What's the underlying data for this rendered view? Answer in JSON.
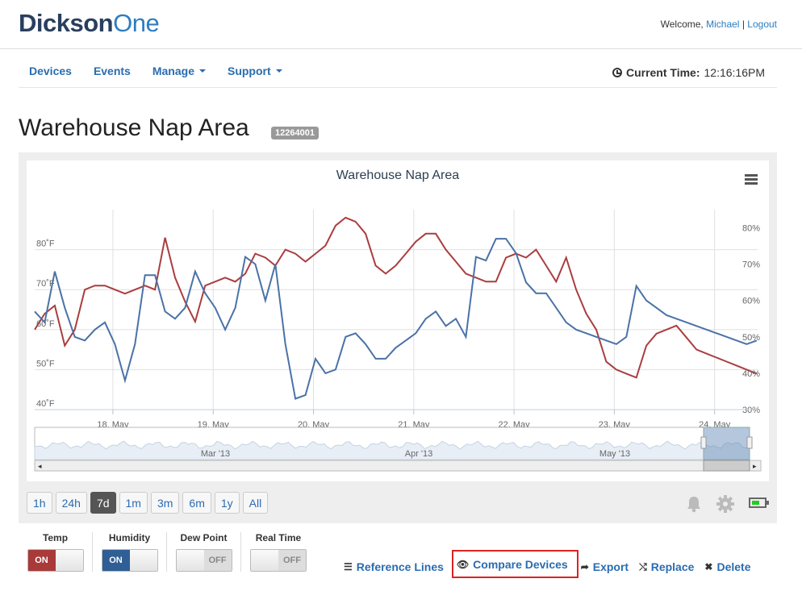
{
  "header": {
    "logo_a": "Dickson",
    "logo_b": "One",
    "welcome": "Welcome,",
    "user": "Michael",
    "separator": "|",
    "logout": "Logout"
  },
  "nav": {
    "devices": "Devices",
    "events": "Events",
    "manage": "Manage",
    "support": "Support",
    "current_time_label": "Current Time:",
    "current_time_value": "12:16:16PM"
  },
  "page": {
    "title": "Warehouse Nap Area",
    "badge": "12264001"
  },
  "chart_data": {
    "type": "line",
    "title": "Warehouse Nap Area",
    "x_ticks": [
      "18. May",
      "19. May",
      "20. May",
      "21. May",
      "22. May",
      "23. May",
      "24. May"
    ],
    "y_left_ticks": [
      "40˚F",
      "50˚F",
      "60˚F",
      "70˚F",
      "80˚F"
    ],
    "y_right_ticks": [
      "30%",
      "40%",
      "50%",
      "60%",
      "70%",
      "80%"
    ],
    "ylim_left": [
      40,
      90
    ],
    "ylim_right": [
      30,
      85
    ],
    "navigator_labels": [
      "Mar '13",
      "Apr '13",
      "May '13"
    ],
    "series": [
      {
        "name": "Temp",
        "color": "#aa3d3f",
        "axis": "left",
        "x": [
          17.0,
          17.1,
          17.2,
          17.3,
          17.4,
          17.5,
          17.6,
          17.7,
          17.8,
          17.9,
          18.0,
          18.1,
          18.2,
          18.3,
          18.4,
          18.5,
          18.6,
          18.7,
          18.8,
          18.9,
          19.0,
          19.1,
          19.2,
          19.3,
          19.4,
          19.5,
          19.6,
          19.7,
          19.8,
          19.9,
          20.0,
          20.1,
          20.2,
          20.3,
          20.4,
          20.5,
          20.6,
          20.7,
          20.8,
          20.9,
          21.0,
          21.1,
          21.2,
          21.3,
          21.4,
          21.5,
          21.6,
          21.7,
          21.8,
          21.9,
          22.0,
          22.1,
          22.2,
          22.3,
          22.4,
          22.5,
          22.6,
          22.7,
          22.8,
          22.9,
          23.0,
          23.1,
          23.2,
          23.3,
          23.4,
          23.5,
          23.6,
          23.7,
          23.8,
          23.9,
          24.0,
          24.1,
          24.2
        ],
        "values": [
          60,
          64,
          66,
          56,
          60,
          70,
          71,
          71,
          70,
          69,
          70,
          71,
          70,
          83,
          73,
          67,
          62,
          71,
          72,
          73,
          72,
          74,
          79,
          78,
          76,
          80,
          79,
          77,
          79,
          81,
          86,
          88,
          87,
          84,
          76,
          74,
          76,
          79,
          82,
          84,
          84,
          80,
          77,
          74,
          73,
          72,
          72,
          78,
          79,
          78,
          80,
          76,
          72,
          78,
          70,
          64,
          60,
          52,
          50,
          49,
          48,
          56,
          59,
          60,
          61,
          58,
          55,
          54,
          53,
          52,
          51,
          50,
          49
        ]
      },
      {
        "name": "Humidity",
        "color": "#4a72a7",
        "axis": "right",
        "x": [
          17.0,
          17.1,
          17.2,
          17.3,
          17.4,
          17.5,
          17.6,
          17.7,
          17.8,
          17.9,
          18.0,
          18.1,
          18.2,
          18.3,
          18.4,
          18.5,
          18.6,
          18.7,
          18.8,
          18.9,
          19.0,
          19.1,
          19.2,
          19.3,
          19.4,
          19.5,
          19.6,
          19.7,
          19.8,
          19.9,
          20.0,
          20.1,
          20.2,
          20.3,
          20.4,
          20.5,
          20.6,
          20.7,
          20.8,
          20.9,
          21.0,
          21.1,
          21.2,
          21.3,
          21.4,
          21.5,
          21.6,
          21.7,
          21.8,
          21.9,
          22.0,
          22.1,
          22.2,
          22.3,
          22.4,
          22.5,
          22.6,
          22.7,
          22.8,
          22.9,
          23.0,
          23.1,
          23.2,
          23.3,
          23.4,
          23.5,
          23.6,
          23.7,
          23.8,
          23.9,
          24.0,
          24.1,
          24.2
        ],
        "values": [
          57,
          54,
          68,
          58,
          50,
          49,
          52,
          54,
          48,
          38,
          48,
          67,
          67,
          57,
          55,
          58,
          68,
          62,
          58,
          52,
          58,
          72,
          70,
          60,
          70,
          48,
          33,
          34,
          44,
          40,
          41,
          50,
          51,
          48,
          44,
          44,
          47,
          49,
          51,
          55,
          57,
          53,
          55,
          50,
          72,
          71,
          77,
          77,
          73,
          65,
          62,
          62,
          58,
          54,
          52,
          51,
          50,
          49,
          48,
          50,
          64,
          60,
          58,
          56,
          55,
          54,
          53,
          52,
          51,
          50,
          49,
          48,
          49
        ]
      }
    ]
  },
  "ranges": [
    "1h",
    "24h",
    "7d",
    "1m",
    "3m",
    "6m",
    "1y",
    "All"
  ],
  "active_range": "7d",
  "toggles": {
    "temp": {
      "label": "Temp",
      "state": "ON"
    },
    "humidity": {
      "label": "Humidity",
      "state": "ON"
    },
    "dewpoint": {
      "label": "Dew Point",
      "state": "OFF"
    },
    "realtime": {
      "label": "Real Time",
      "state": "OFF"
    }
  },
  "actions": {
    "reference_lines": "Reference Lines",
    "compare_devices": "Compare Devices",
    "export": "Export",
    "replace": "Replace",
    "delete": "Delete"
  },
  "icons": {
    "clock": "clock-icon",
    "menu": "menu-icon",
    "bell": "bell-icon",
    "gear": "gear-icon",
    "battery": "battery-icon"
  },
  "colors": {
    "brand_dark": "#2a3f5f",
    "brand_blue": "#2e7dc1",
    "link": "#2a6cb0",
    "temp": "#aa3d3f",
    "humidity": "#4a72a7",
    "highlight": "#dd2222"
  }
}
